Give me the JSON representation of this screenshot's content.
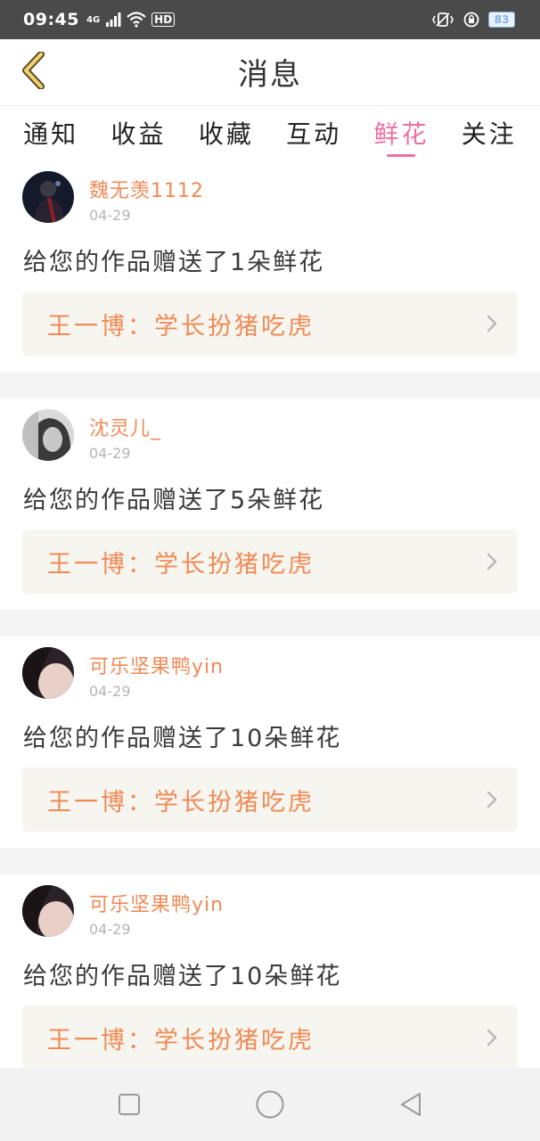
{
  "status_bar": {
    "time": "09:45",
    "network": "4G",
    "hd": "HD",
    "battery": "83"
  },
  "header": {
    "title": "消息",
    "back_icon": "chevron-left-icon"
  },
  "tabs": [
    {
      "label": "通知",
      "active": false
    },
    {
      "label": "收益",
      "active": false
    },
    {
      "label": "收藏",
      "active": false
    },
    {
      "label": "互动",
      "active": false
    },
    {
      "label": "鲜花",
      "active": true
    },
    {
      "label": "关注",
      "active": false
    }
  ],
  "colors": {
    "accent_pink": "#ee6fa3",
    "name_orange": "#f08a55",
    "card_bg": "#f6f5ef"
  },
  "messages": [
    {
      "name": "魏无羡1112",
      "date": "04-29",
      "text": "给您的作品赠送了1朵鲜花",
      "work": "王一博：学长扮猪吃虎"
    },
    {
      "name": "沈灵儿_",
      "date": "04-29",
      "text": "给您的作品赠送了5朵鲜花",
      "work": "王一博：学长扮猪吃虎"
    },
    {
      "name": "可乐坚果鸭yin",
      "date": "04-29",
      "text": "给您的作品赠送了10朵鲜花",
      "work": "王一博：学长扮猪吃虎"
    },
    {
      "name": "可乐坚果鸭yin",
      "date": "04-29",
      "text": "给您的作品赠送了10朵鲜花",
      "work": "王一博：学长扮猪吃虎"
    }
  ],
  "navbar": {
    "items": [
      "recent-apps-icon",
      "home-icon",
      "back-icon"
    ]
  }
}
